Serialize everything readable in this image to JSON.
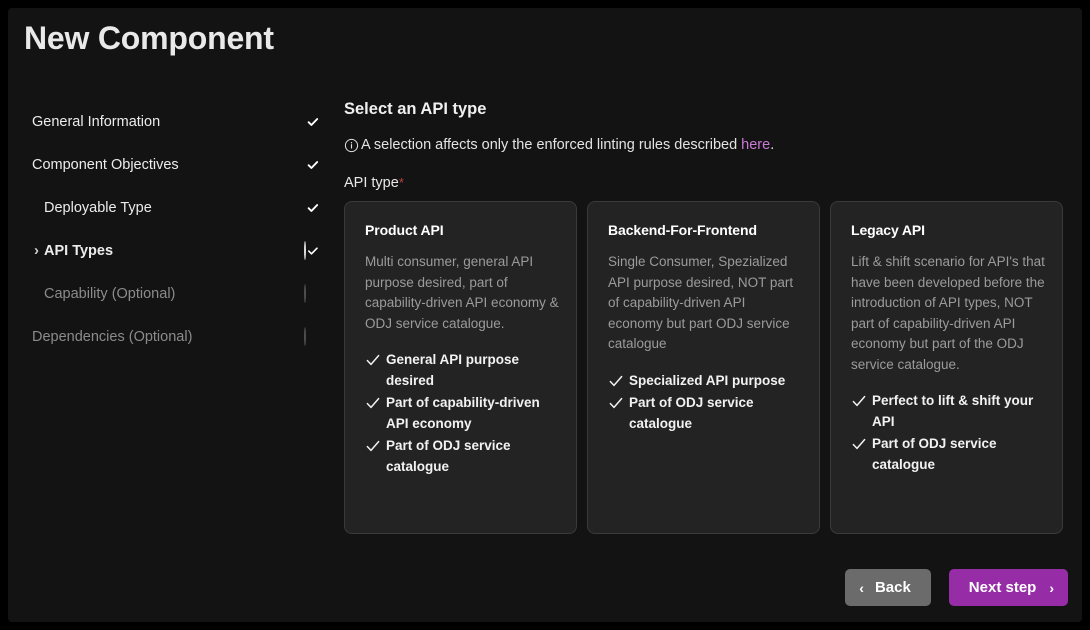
{
  "window": {
    "title": "New Component"
  },
  "sidebar": {
    "steps": [
      {
        "label": "General Information",
        "status": "done",
        "indent": false,
        "caret": "",
        "muted": false,
        "active": false
      },
      {
        "label": "Component Objectives",
        "status": "done",
        "indent": false,
        "caret": "",
        "muted": false,
        "active": false
      },
      {
        "label": "Deployable Type",
        "status": "done",
        "indent": true,
        "caret": "",
        "muted": false,
        "active": false
      },
      {
        "label": "API Types",
        "status": "current",
        "indent": true,
        "caret": "›",
        "muted": false,
        "active": true
      },
      {
        "label": "Capability (Optional)",
        "status": "empty",
        "indent": true,
        "caret": "",
        "muted": true,
        "active": false
      },
      {
        "label": "Dependencies (Optional)",
        "status": "empty",
        "indent": false,
        "caret": "",
        "muted": true,
        "active": false
      }
    ]
  },
  "main": {
    "title": "Select an API type",
    "hint_icon": "info-circle-icon",
    "hint_text": "A selection affects only the enforced linting rules described",
    "hint_link": "here",
    "hint_suffix": ".",
    "field_label": "API type",
    "required_marker": "*",
    "cards": [
      {
        "title": "Product API",
        "description": "Multi consumer, general API purpose desired, part of capability-driven API economy & ODJ service catalogue.",
        "bullets": [
          "General API purpose desired",
          "Part of capability-driven API economy",
          "Part of ODJ service catalogue"
        ]
      },
      {
        "title": "Backend-For-Frontend",
        "description": "Single Consumer, Spezialized API purpose desired, NOT part of capability-driven API economy but part ODJ service catalogue",
        "bullets": [
          "Specialized API purpose",
          "Part of ODJ service catalogue"
        ]
      },
      {
        "title": "Legacy API",
        "description": "Lift & shift scenario for API's that have been developed before the introduction of API types, NOT part of capability-driven API economy but part of the ODJ service catalogue.",
        "bullets": [
          "Perfect to lift & shift your API",
          "Part of ODJ service catalogue"
        ]
      }
    ]
  },
  "footer": {
    "back_label": "Back",
    "back_chevron": "‹",
    "next_label": "Next step",
    "next_chevron": "›"
  },
  "colors": {
    "page_background": "#000000",
    "panel_background": "#131313",
    "card_background": "#232323",
    "card_border": "#3a3a3a",
    "accent_purple": "#962da6",
    "link_purple": "#c97ad6",
    "status_green": "#5ca75c",
    "required_red": "#b9453c",
    "back_gray": "#6b6b6b"
  }
}
